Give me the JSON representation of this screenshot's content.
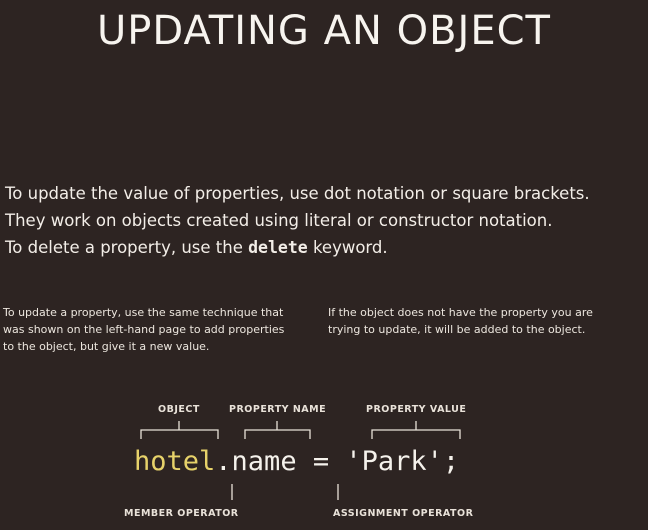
{
  "title": "UPDATING AN OBJECT",
  "intro": {
    "line1": "To update the value of properties, use dot notation or square brackets.",
    "line2": "They work on objects created using literal or constructor notation.",
    "line3_pre": "To delete a property, use the ",
    "line3_keyword": "delete",
    "line3_post": " keyword."
  },
  "notes": {
    "left": [
      "To update a property, use the same technique that",
      "was shown on the left-hand page to add properties",
      "to the object, but give it a new value."
    ],
    "right": [
      "If the object does not have the property you are",
      "trying to update, it will be added to the object."
    ]
  },
  "diagram": {
    "labels": {
      "object": "OBJECT",
      "property_name": "PROPERTY NAME",
      "property_value": "PROPERTY VALUE",
      "member_operator": "MEMBER OPERATOR",
      "assignment_operator": "ASSIGNMENT OPERATOR"
    },
    "code": {
      "object": "hotel",
      "dot": ".",
      "property": "name",
      "equals": " = ",
      "value": "'Park'",
      "semicolon": ";"
    },
    "colors": {
      "object": "#e7d26a",
      "code": "#f5f2ec"
    }
  }
}
